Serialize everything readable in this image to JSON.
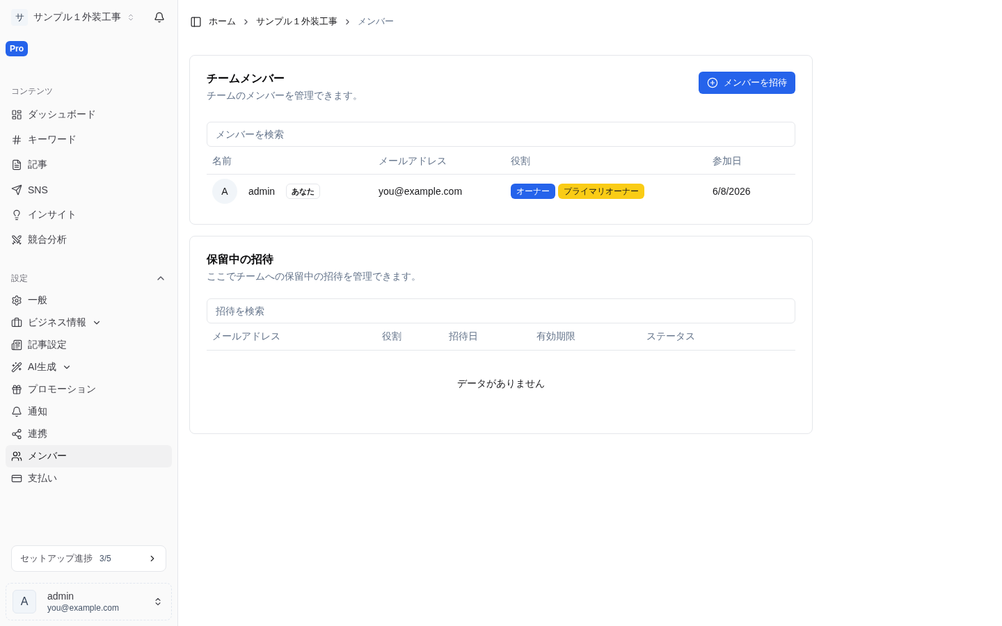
{
  "sidebar": {
    "org": {
      "initial": "サ",
      "name": "サンプル１外装工事"
    },
    "plan_badge": "Pro",
    "groups": [
      {
        "label": "コンテンツ",
        "items": [
          {
            "label": "ダッシュボード",
            "selected": false
          },
          {
            "label": "キーワード",
            "selected": false
          },
          {
            "label": "記事",
            "selected": false
          },
          {
            "label": "SNS",
            "selected": false
          },
          {
            "label": "インサイト",
            "selected": false
          },
          {
            "label": "競合分析",
            "selected": false
          }
        ]
      },
      {
        "label": "設定",
        "expanded": true,
        "items": [
          {
            "label": "一般",
            "selected": false
          },
          {
            "label": "ビジネス情報",
            "selected": false,
            "expanded": false
          },
          {
            "label": "記事設定",
            "selected": false
          },
          {
            "label": "AI生成",
            "selected": false,
            "expanded": false
          },
          {
            "label": "プロモーション",
            "selected": false
          },
          {
            "label": "通知",
            "selected": false
          },
          {
            "label": "連携",
            "selected": false
          },
          {
            "label": "メンバー",
            "selected": true
          },
          {
            "label": "支払い",
            "selected": false
          }
        ]
      }
    ],
    "setup_progress": {
      "label": "セットアップ進捗",
      "count": "3/5"
    },
    "user": {
      "initial": "A",
      "name": "admin",
      "email": "you@example.com"
    }
  },
  "breadcrumb": [
    {
      "label": "ホーム",
      "current": false
    },
    {
      "label": "サンプル１外装工事",
      "current": false
    },
    {
      "label": "メンバー",
      "current": true
    }
  ],
  "members_card": {
    "title": "チームメンバー",
    "description": "チームのメンバーを管理できます。",
    "invite_button": "メンバーを招待",
    "search": {
      "placeholder": "メンバーを検索"
    },
    "table": {
      "columns": [
        "名前",
        "メールアドレス",
        "役割",
        "参加日"
      ],
      "rows": [
        {
          "initial": "A",
          "name": "admin",
          "self_badge": "あなた",
          "email": "you@example.com",
          "roles": [
            {
              "label": "オーナー",
              "color": "#2563eb"
            },
            {
              "label": "プライマリオーナー",
              "color": "#facc15"
            }
          ],
          "joined": "6/8/2026"
        }
      ]
    }
  },
  "invitations_card": {
    "title": "保留中の招待",
    "description": "ここでチームへの保留中の招待を管理できます。",
    "search": {
      "placeholder": "招待を検索"
    },
    "table": {
      "columns": [
        "メールアドレス",
        "役割",
        "招待日",
        "有効期限",
        "ステータス"
      ],
      "empty_message": "データがありません"
    }
  }
}
